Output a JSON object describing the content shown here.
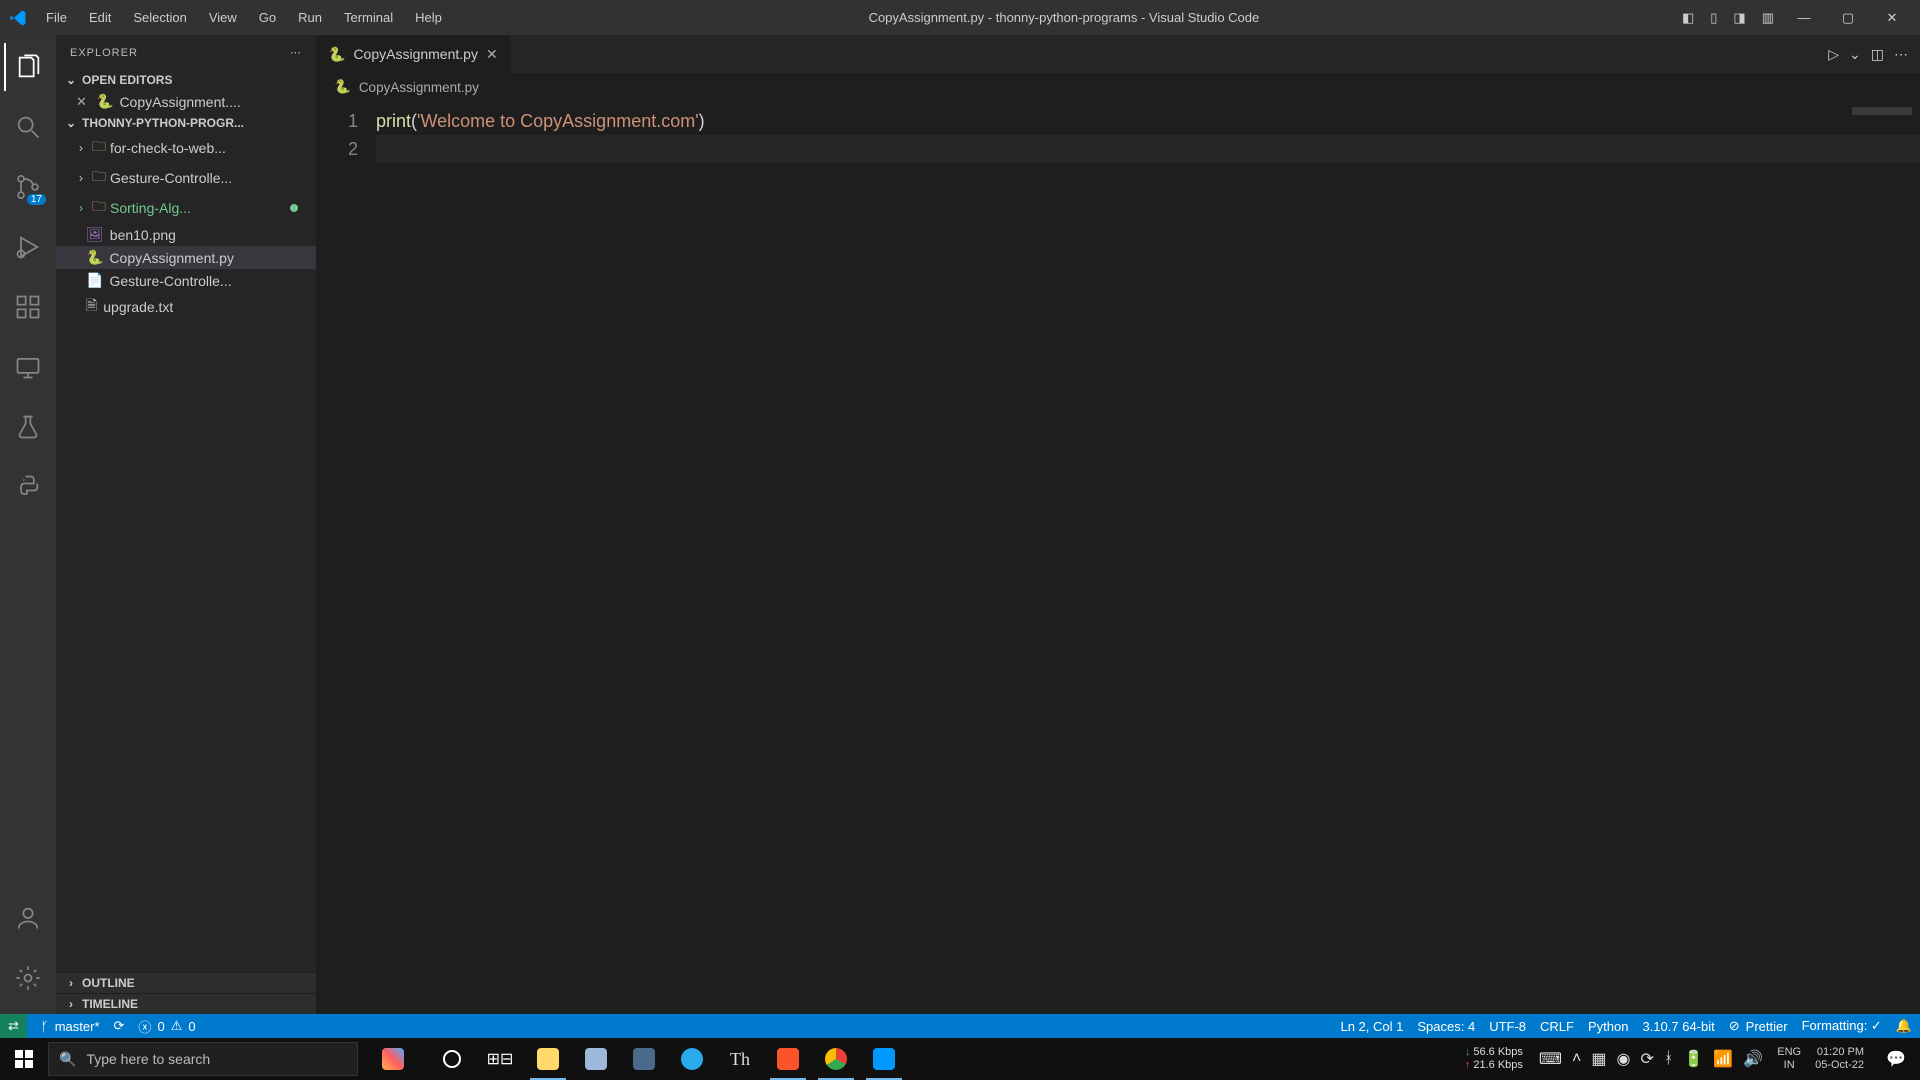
{
  "titlebar": {
    "title": "CopyAssignment.py - thonny-python-programs - Visual Studio Code",
    "menu": [
      "File",
      "Edit",
      "Selection",
      "View",
      "Go",
      "Run",
      "Terminal",
      "Help"
    ]
  },
  "activitybar": {
    "scm_badge": "17"
  },
  "sidebar": {
    "title": "EXPLORER",
    "open_editors_label": "OPEN EDITORS",
    "open_editors": [
      {
        "name": "CopyAssignment...."
      }
    ],
    "workspace_label": "THONNY-PYTHON-PROGR...",
    "folders": [
      {
        "name": "for-check-to-web..."
      },
      {
        "name": "Gesture-Controlle..."
      },
      {
        "name": "Sorting-Alg...",
        "gitNew": true
      }
    ],
    "files": [
      {
        "name": "ben10.png",
        "iconClass": "imgico"
      },
      {
        "name": "CopyAssignment.py",
        "iconClass": "pyico",
        "selected": true
      },
      {
        "name": "Gesture-Controlle...",
        "iconClass": "mdico"
      },
      {
        "name": "upgrade.txt",
        "iconClass": "txtico"
      }
    ],
    "outline_label": "OUTLINE",
    "timeline_label": "TIMELINE"
  },
  "editor": {
    "tab_name": "CopyAssignment.py",
    "breadcrumb": "CopyAssignment.py",
    "code": {
      "fn": "print",
      "open": "(",
      "str": "'Welcome to CopyAssignment.com'",
      "close": ")"
    },
    "line_numbers": [
      "1",
      "2"
    ]
  },
  "statusbar": {
    "branch": "master*",
    "errors": "0",
    "warnings": "0",
    "position": "Ln 2, Col 1",
    "spaces": "Spaces: 4",
    "encoding": "UTF-8",
    "eol": "CRLF",
    "language": "Python",
    "interpreter": "3.10.7 64-bit",
    "prettier": "Prettier",
    "formatting": "Formatting: ✓"
  },
  "taskbar": {
    "search_placeholder": "Type here to search",
    "net_down": "56.6 Kbps",
    "net_up": "21.6 Kbps",
    "lang1": "ENG",
    "lang2": "IN",
    "time": "01:20 PM",
    "date": "05-Oct-22"
  }
}
